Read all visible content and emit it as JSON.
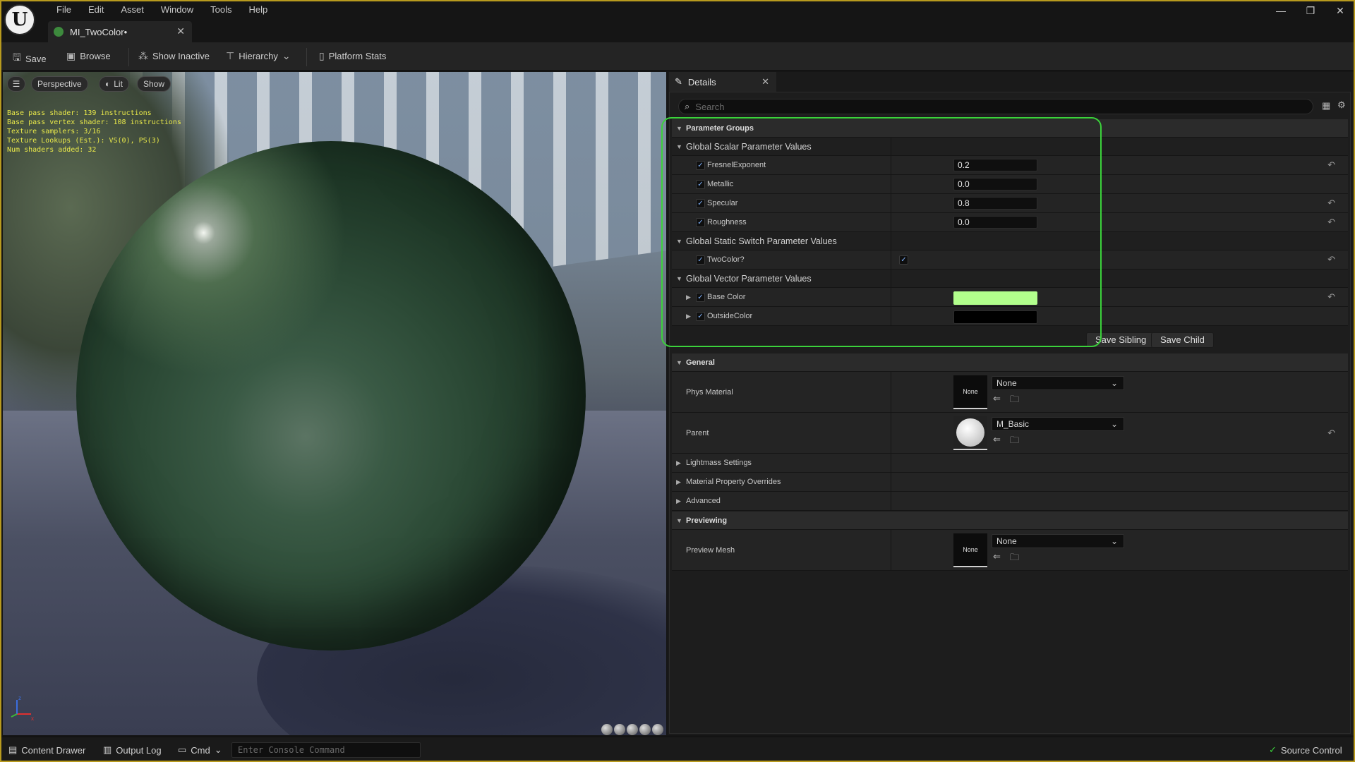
{
  "menubar": {
    "items": [
      "File",
      "Edit",
      "Asset",
      "Window",
      "Tools",
      "Help"
    ]
  },
  "tab": {
    "title": "MI_TwoColor•"
  },
  "toolbar": {
    "save": "Save",
    "browse": "Browse",
    "show_inactive": "Show Inactive",
    "hierarchy": "Hierarchy",
    "platform_stats": "Platform Stats"
  },
  "viewport": {
    "perspective": "Perspective",
    "lit": "Lit",
    "show": "Show",
    "stats": [
      "Base pass shader: 139 instructions",
      "Base pass vertex shader: 108 instructions",
      "Texture samplers: 3/16",
      "Texture Lookups (Est.): VS(0), PS(3)",
      "Num shaders added: 32"
    ]
  },
  "details": {
    "tab_title": "Details",
    "search_placeholder": "Search",
    "parameter_groups": "Parameter Groups",
    "scalar_group": "Global Scalar Parameter Values",
    "scalars": [
      {
        "name": "FresnelExponent",
        "value": "0.2",
        "modified": true
      },
      {
        "name": "Metallic",
        "value": "0.0",
        "modified": false
      },
      {
        "name": "Specular",
        "value": "0.8",
        "modified": true
      },
      {
        "name": "Roughness",
        "value": "0.0",
        "modified": true
      }
    ],
    "switch_group": "Global Static Switch Parameter Values",
    "switches": [
      {
        "name": "TwoColor?",
        "value": true
      }
    ],
    "vector_group": "Global Vector Parameter Values",
    "vectors": [
      {
        "name": "Base Color",
        "color": "#b2ff8c"
      },
      {
        "name": "OutsideColor",
        "color": "#000000"
      }
    ],
    "save_sibling": "Save Sibling",
    "save_child": "Save Child",
    "general": "General",
    "phys_material": {
      "label": "Phys Material",
      "thumb": "None",
      "value": "None"
    },
    "parent": {
      "label": "Parent",
      "value": "M_Basic"
    },
    "lightmass": "Lightmass Settings",
    "overrides": "Material Property Overrides",
    "advanced": "Advanced",
    "previewing": "Previewing",
    "preview_mesh": {
      "label": "Preview Mesh",
      "thumb": "None",
      "value": "None"
    }
  },
  "statusbar": {
    "content_drawer": "Content Drawer",
    "output_log": "Output Log",
    "cmd": "Cmd",
    "console_placeholder": "Enter Console Command",
    "source_control": "Source Control"
  },
  "colors": {
    "accent_highlight": "#3bd23b",
    "window_border": "#b89a1e",
    "checkbox": "#7fb3ff"
  }
}
